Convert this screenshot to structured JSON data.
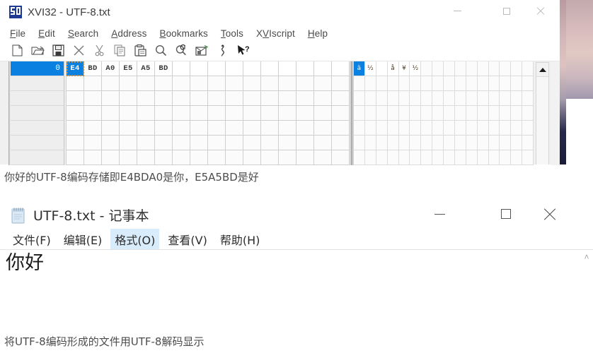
{
  "hex_editor": {
    "window_title": "XVI32 - UTF-8.txt",
    "app_icon": "xvi32-icon",
    "window_controls": {
      "minimize": "minimize-icon",
      "maximize": "maximize-icon",
      "close": "close-icon"
    },
    "menu": [
      {
        "label": "File",
        "accel": "F"
      },
      {
        "label": "Edit",
        "accel": "E"
      },
      {
        "label": "Search",
        "accel": "S"
      },
      {
        "label": "Address",
        "accel": "A"
      },
      {
        "label": "Bookmarks",
        "accel": "B"
      },
      {
        "label": "Tools",
        "accel": "T"
      },
      {
        "label": "XVIscript",
        "accel": "V"
      },
      {
        "label": "Help",
        "accel": "H"
      }
    ],
    "toolbar": [
      {
        "name": "new-file-icon",
        "title": "New"
      },
      {
        "name": "open-file-icon",
        "title": "Open"
      },
      {
        "name": "save-file-icon",
        "title": "Save"
      },
      {
        "name": "delete-icon",
        "title": "Delete"
      },
      {
        "name": "cut-icon",
        "title": "Cut"
      },
      {
        "name": "copy-icon",
        "title": "Copy"
      },
      {
        "name": "paste-icon",
        "title": "Paste"
      },
      {
        "name": "find-icon",
        "title": "Find"
      },
      {
        "name": "find-replace-icon",
        "title": "Replace"
      },
      {
        "name": "goto-address-icon",
        "title": "Address"
      },
      {
        "name": "script-icon",
        "title": "XVIscript"
      },
      {
        "name": "help-pointer-icon",
        "title": "Help"
      }
    ],
    "address_rows": [
      "0",
      "",
      "",
      "",
      "",
      "",
      ""
    ],
    "selected_address_row": 0,
    "hex_bytes": [
      "E4",
      "BD",
      "A0",
      "E5",
      "A5",
      "BD"
    ],
    "cursor_byte_index": 0,
    "hex_columns": 16,
    "hex_rows": 7,
    "char_glyphs": [
      "ä",
      "½",
      " ",
      "å",
      "¥",
      "½"
    ],
    "char_columns": 16,
    "scrollbar": {
      "up_arrow": "scroll-up-arrow-icon"
    },
    "accent_color": "#0a80e0",
    "cursor_border_color": "#c08a3e"
  },
  "caption_1": "你好的UTF-8编码存储即E4BDA0是你，E5A5BD是好",
  "notepad": {
    "window_title": "UTF-8.txt - 记事本",
    "app_icon": "notepad-icon",
    "window_controls": {
      "minimize": "minimize-icon",
      "maximize": "maximize-icon",
      "close": "close-icon"
    },
    "menu": [
      {
        "label": "文件(F)",
        "active": false
      },
      {
        "label": "编辑(E)",
        "active": false
      },
      {
        "label": "格式(O)",
        "active": true
      },
      {
        "label": "查看(V)",
        "active": false
      },
      {
        "label": "帮助(H)",
        "active": false
      }
    ],
    "content": "你好",
    "scrollbar": {
      "up_arrow": "˄"
    },
    "active_menu_highlight": "#d9ecfb"
  },
  "caption_2": "将UTF-8编码形成的文件用UTF-8解码显示"
}
